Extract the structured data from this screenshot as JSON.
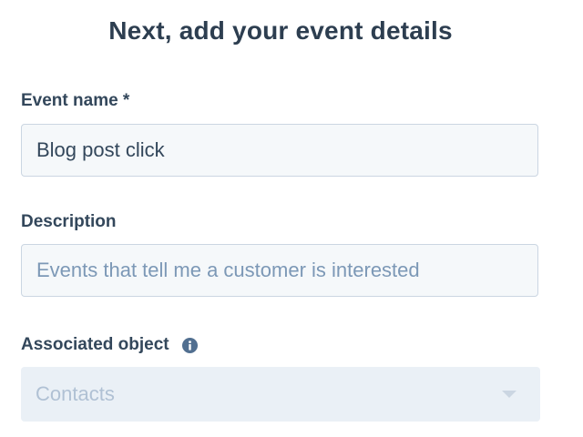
{
  "header": {
    "title": "Next, add your event details"
  },
  "form": {
    "event_name": {
      "label": "Event name *",
      "value": "Blog post click"
    },
    "description": {
      "label": "Description",
      "placeholder": "Events that tell me a customer is interested"
    },
    "associated_object": {
      "label": "Associated object",
      "info_icon": "info-icon",
      "selected": "Contacts",
      "disabled": true
    }
  },
  "colors": {
    "text": "#33475b",
    "input_bg": "#f5f8fa",
    "input_border": "#cbd6e2",
    "placeholder": "#7c98b6",
    "disabled_bg": "#eaf0f6",
    "disabled_text": "#b0c1d4"
  }
}
